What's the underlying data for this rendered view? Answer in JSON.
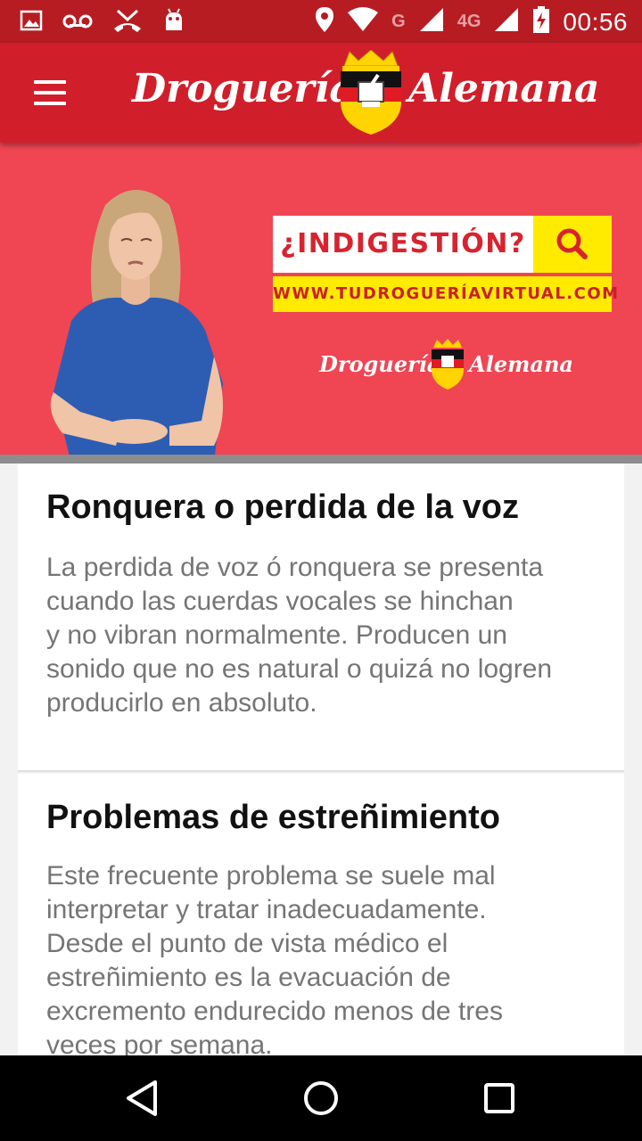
{
  "status_bar": {
    "time": "00:56",
    "network_label_1": "G",
    "network_label_2": "4G"
  },
  "app_bar": {
    "logo_left": "Droguería",
    "logo_right": "Alemana"
  },
  "banner": {
    "headline": "¿INDIGESTIÓN?",
    "url": "WWW.TUDROGUERÍAVIRTUAL.COM",
    "logo_left": "Droguería",
    "logo_right": "Alemana"
  },
  "articles": [
    {
      "title": "Ronquera o perdida de la voz",
      "lines": [
        "La perdida de voz ó ronquera se presenta",
        "cuando las cuerdas vocales se hinchan",
        "y no vibran normalmente. Producen un",
        "sonido que no es natural o quizá no logren",
        "producirlo en absoluto."
      ]
    },
    {
      "title": "Problemas de estreñimiento",
      "lines": [
        "Este frecuente problema se suele mal",
        "interpretar y tratar inadecuadamente.",
        "Desde el punto de vista médico el",
        "estreñimiento es la evacuación de",
        "excremento endurecido menos de tres",
        "veces por semana."
      ]
    }
  ],
  "colors": {
    "status_bar": "#b71c23",
    "app_bar": "#d01f2b",
    "banner_bg": "#f04553",
    "accent_yellow": "#ffeb00"
  }
}
